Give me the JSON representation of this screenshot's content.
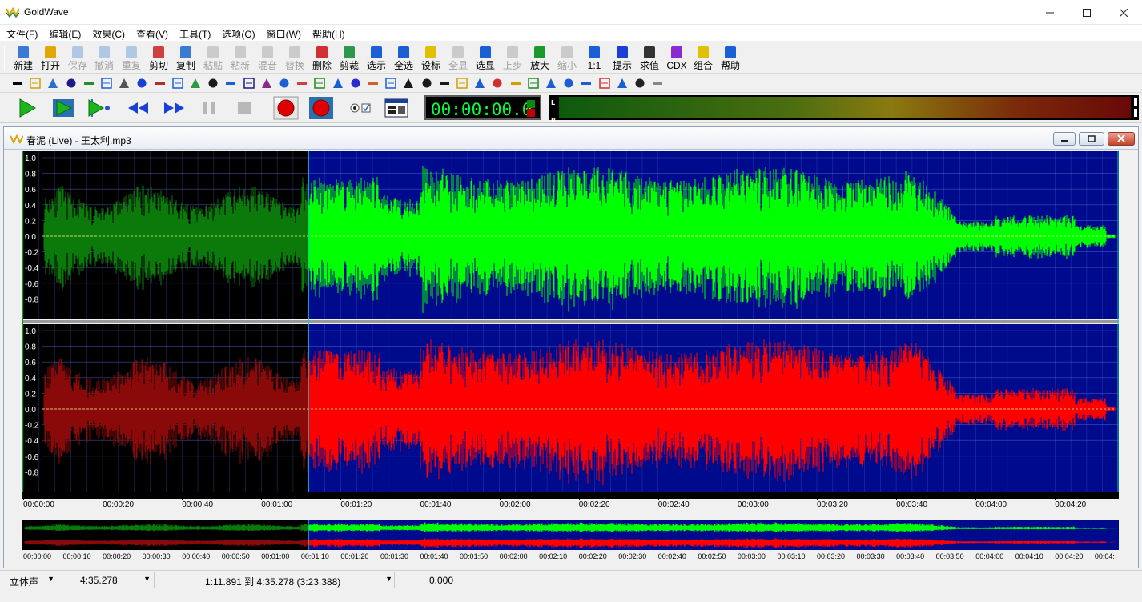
{
  "app": {
    "title": "GoldWave",
    "window_controls": [
      "minimize-icon",
      "maximize-icon",
      "close-icon"
    ]
  },
  "menu": [
    "文件(F)",
    "编辑(E)",
    "效果(C)",
    "查看(V)",
    "工具(T)",
    "选项(O)",
    "窗口(W)",
    "帮助(H)"
  ],
  "toolbar": [
    {
      "label": "新建",
      "icon": "new-file-icon",
      "enabled": true
    },
    {
      "label": "打开",
      "icon": "open-folder-icon",
      "enabled": true
    },
    {
      "label": "保存",
      "icon": "save-icon",
      "enabled": false
    },
    {
      "label": "撤消",
      "icon": "undo-icon",
      "enabled": false
    },
    {
      "label": "重复",
      "icon": "redo-icon",
      "enabled": false
    },
    {
      "label": "剪切",
      "icon": "scissors-icon",
      "enabled": true
    },
    {
      "label": "复制",
      "icon": "copy-icon",
      "enabled": true
    },
    {
      "label": "粘贴",
      "icon": "paste-icon",
      "enabled": false
    },
    {
      "label": "粘新",
      "icon": "paste-new-icon",
      "enabled": false
    },
    {
      "label": "混音",
      "icon": "mix-icon",
      "enabled": false
    },
    {
      "label": "替换",
      "icon": "replace-icon",
      "enabled": false
    },
    {
      "label": "删除",
      "icon": "delete-icon",
      "enabled": true
    },
    {
      "label": "剪裁",
      "icon": "trim-icon",
      "enabled": true
    },
    {
      "label": "选示",
      "icon": "select-view-icon",
      "enabled": true
    },
    {
      "label": "全选",
      "icon": "select-all-icon",
      "enabled": true
    },
    {
      "label": "设标",
      "icon": "set-marker-icon",
      "enabled": true
    },
    {
      "label": "全显",
      "icon": "zoom-all-icon",
      "enabled": false
    },
    {
      "label": "选显",
      "icon": "zoom-selection-icon",
      "enabled": true
    },
    {
      "label": "上步",
      "icon": "zoom-previous-icon",
      "enabled": false
    },
    {
      "label": "放大",
      "icon": "zoom-in-icon",
      "enabled": true
    },
    {
      "label": "缩小",
      "icon": "zoom-out-icon",
      "enabled": false
    },
    {
      "label": "1:1",
      "icon": "zoom-1to1-icon",
      "enabled": true
    },
    {
      "label": "提示",
      "icon": "cue-icon",
      "enabled": true
    },
    {
      "label": "求值",
      "icon": "evaluator-icon",
      "enabled": true
    },
    {
      "label": "CDX",
      "icon": "cd-extract-icon",
      "enabled": true
    },
    {
      "label": "组合",
      "icon": "combine-icon",
      "enabled": true
    },
    {
      "label": "帮助",
      "icon": "help-icon",
      "enabled": true
    }
  ],
  "effects_toolbar": {
    "icons": [
      "flat-icon",
      "stereo-icon",
      "cross-icon",
      "shift-icon",
      "align-icon",
      "compress-icon",
      "envelope-icon",
      "loop-icon",
      "doppler-icon",
      "equalizer-icon",
      "filter-icon",
      "grid-icon",
      "back-arrow-icon",
      "pitch-icon",
      "mixer-icon",
      "delay-icon",
      "reverb-icon",
      "spectrum-icon",
      "flanger-icon",
      "echo-icon",
      "noise-icon",
      "stereo-width-icon",
      "level-icon",
      "volume-icon",
      "volume-loud-icon",
      "volume-soft-icon",
      "fade-icon",
      "invert-icon",
      "dc-offset-icon",
      "channel-mixer-icon",
      "resample-icon",
      "hz-icon",
      "swap-icon",
      "restore-icon",
      "reverse-icon",
      "settings-gear-icon",
      "mail-icon"
    ]
  },
  "transport": {
    "buttons": [
      "play-icon",
      "play-selection-icon",
      "play-from-cursor-icon",
      "rewind-icon",
      "fast-forward-icon",
      "pause-icon",
      "stop-icon",
      "record-icon",
      "record-selection-icon",
      "device-toggle-icon",
      "control-properties-icon"
    ],
    "time": "00:00:00.0",
    "meter_channels": [
      "L",
      "R"
    ]
  },
  "document": {
    "title": "春泥 (Live) - 王太利.mp3",
    "amplitude_labels": [
      "1.0",
      "0.8",
      "0.6",
      "0.4",
      "0.2",
      "0.0",
      "-0.2",
      "-0.4",
      "-0.6",
      "-0.8"
    ],
    "timeline_labels": [
      "00:00:00",
      "00:00:20",
      "00:00:40",
      "00:01:00",
      "00:01:20",
      "00:01:40",
      "00:02:00",
      "00:02:20",
      "00:02:40",
      "00:03:00",
      "00:03:20",
      "00:03:40",
      "00:04:00",
      "00:04:20"
    ],
    "overview_labels": [
      "00:00:00",
      "00:00:10",
      "00:00:20",
      "00:00:30",
      "00:00:40",
      "00:00:50",
      "00:01:00",
      "00:01:10",
      "00:01:20",
      "00:01:30",
      "00:01:40",
      "00:01:50",
      "00:02:00",
      "00:02:10",
      "00:02:20",
      "00:02:30",
      "00:02:40",
      "00:02:50",
      "00:03:00",
      "00:03:10",
      "00:03:20",
      "00:03:30",
      "00:03:40",
      "00:03:50",
      "00:04:00",
      "00:04:10",
      "00:04:20",
      "00:04:"
    ],
    "duration_seconds": 275.278,
    "selection_start_seconds": 71.891,
    "selection_end_seconds": 275.278,
    "colors": {
      "selected_bg": "#000a8c",
      "unselected_bg": "#000000",
      "left_selected": "#00ff00",
      "left_unselected": "#0b7a0b",
      "right_selected": "#ff0000",
      "right_unselected": "#8a0a0a",
      "grid": "#5a6bd0",
      "zero_line": "#ffff80"
    }
  },
  "status": {
    "channels": "立体声",
    "length": "4:35.278",
    "selection": "1:11.891 到 4:35.278 (3:23.388)",
    "position": "0.000"
  }
}
